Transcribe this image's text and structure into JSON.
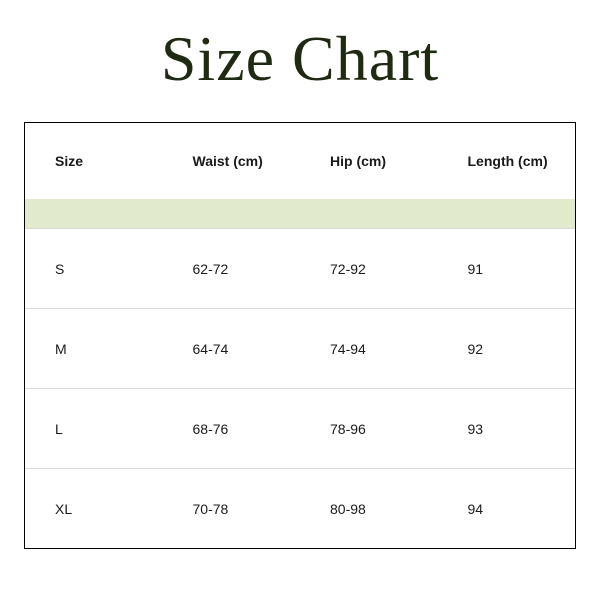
{
  "title": "Size Chart",
  "columns": [
    "Size",
    "Waist (cm)",
    "Hip (cm)",
    "Length (cm)"
  ],
  "rows": [
    {
      "size": "S",
      "waist": "62-72",
      "hip": "72-92",
      "length": "91"
    },
    {
      "size": "M",
      "waist": "64-74",
      "hip": "74-94",
      "length": "92"
    },
    {
      "size": "L",
      "waist": "68-76",
      "hip": "78-96",
      "length": "93"
    },
    {
      "size": "XL",
      "waist": "70-78",
      "hip": "80-98",
      "length": "94"
    }
  ],
  "chart_data": {
    "type": "table",
    "title": "Size Chart",
    "columns": [
      "Size",
      "Waist (cm)",
      "Hip (cm)",
      "Length (cm)"
    ],
    "rows": [
      [
        "S",
        "62-72",
        "72-92",
        91
      ],
      [
        "M",
        "64-74",
        "74-94",
        92
      ],
      [
        "L",
        "68-76",
        "78-96",
        93
      ],
      [
        "XL",
        "70-78",
        "80-98",
        94
      ]
    ]
  }
}
